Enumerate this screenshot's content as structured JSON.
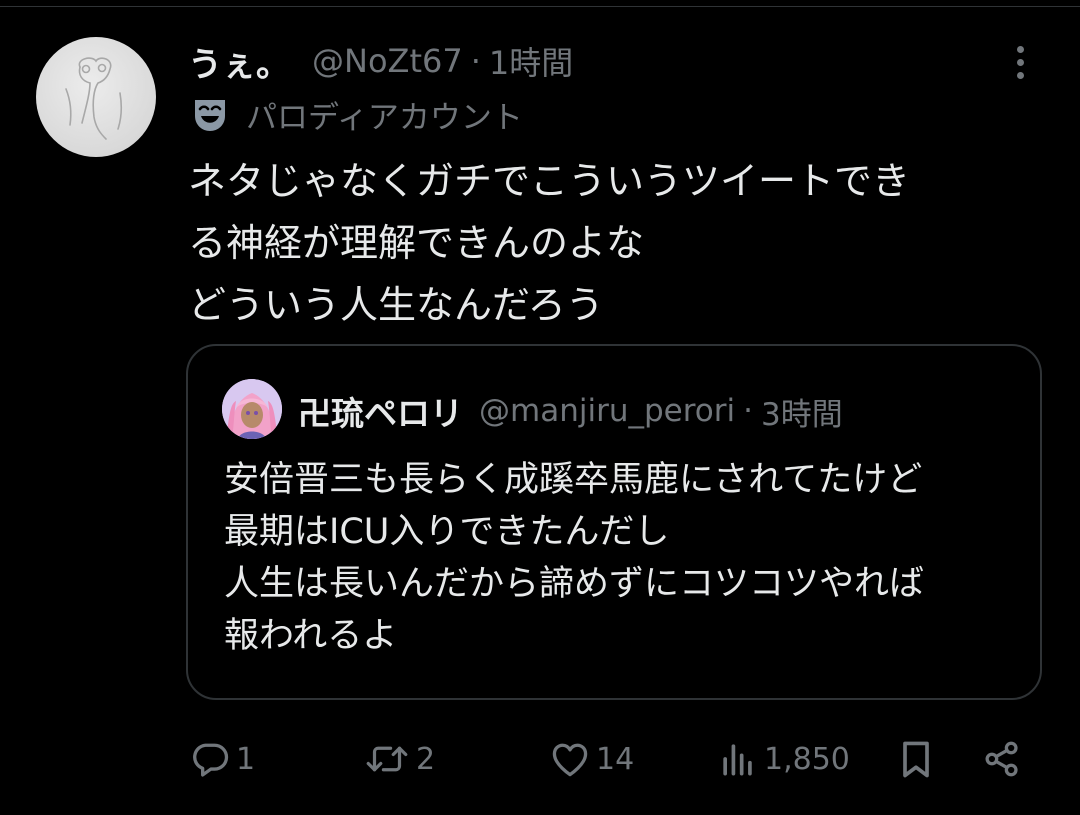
{
  "tweet": {
    "display_name": "うぇ。",
    "handle": "@NoZt67",
    "separator": "·",
    "time": "1時間",
    "parody_label": "パロディアカウント",
    "body_lines": [
      "ネタじゃなくガチでこういうツイートでき",
      "る神経が理解できんのよな",
      "どういう人生なんだろう"
    ]
  },
  "quote": {
    "display_name": "卍琉ペロリ",
    "handle": "@manjiru_perori",
    "separator": "·",
    "time": "3時間",
    "body_lines": [
      "安倍晋三も長らく成蹊卒馬鹿にされてたけど",
      "最期はICU入りできたんだし",
      "人生は長いんだから諦めずにコツコツやれば",
      "報われるよ"
    ]
  },
  "actions": {
    "reply_count": "1",
    "retweet_count": "2",
    "like_count": "14",
    "view_count": "1,850"
  },
  "icons": {
    "more": "more-vertical-icon",
    "parody": "theater-mask-icon",
    "reply": "reply-bubble-icon",
    "retweet": "retweet-icon",
    "like": "heart-icon",
    "views": "bar-chart-icon",
    "bookmark": "bookmark-icon",
    "share": "share-icon"
  },
  "colors": {
    "background": "#000000",
    "primary_text": "#e7e9ea",
    "secondary_text": "#71767b",
    "border": "#2f3336"
  }
}
